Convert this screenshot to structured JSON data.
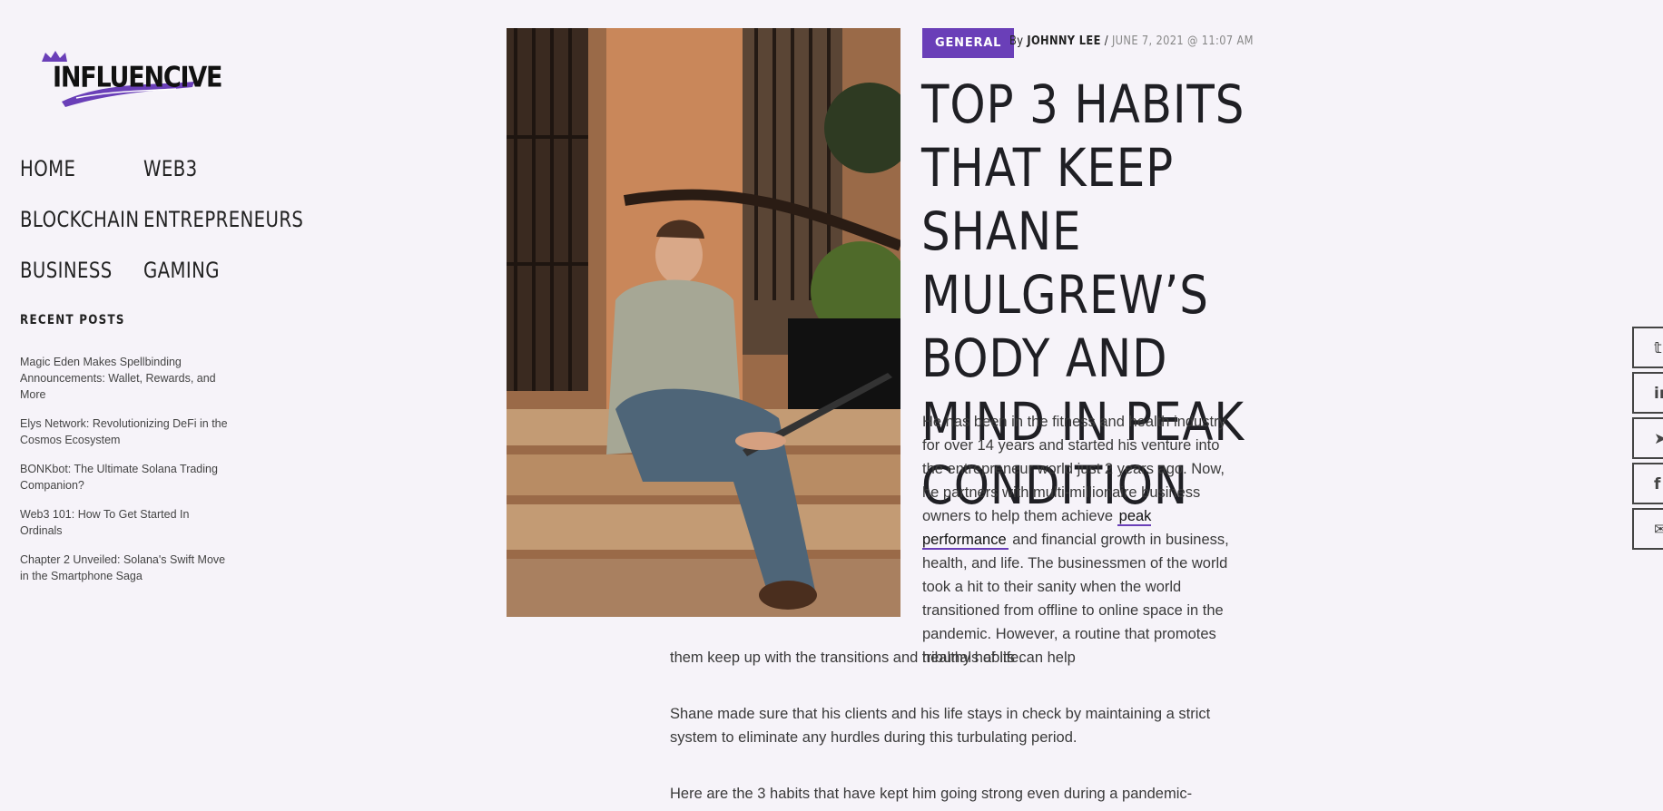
{
  "site": {
    "logo_text": "INFLUENCIVE"
  },
  "nav": {
    "items": [
      {
        "label": "HOME"
      },
      {
        "label": "WEB3"
      },
      {
        "label": "BLOCKCHAIN"
      },
      {
        "label": "ENTREPRENEURS"
      },
      {
        "label": "BUSINESS"
      },
      {
        "label": "GAMING"
      }
    ]
  },
  "sidebar": {
    "recent_title": "RECENT POSTS",
    "recent_posts": [
      "Magic Eden Makes Spellbinding Announcements: Wallet, Rewards, and More",
      "Elys Network: Revolutionizing DeFi in the Cosmos Ecosystem",
      "BONKbot: The Ultimate Solana Trading Companion?",
      "Web3 101: How To Get Started In Ordinals",
      "Chapter 2 Unveiled: Solana's Swift Move in the Smartphone Saga"
    ]
  },
  "article": {
    "category": "GENERAL",
    "by": "By",
    "author": "JOHNNY LEE",
    "separator": "/",
    "date": "JUNE 7, 2021 @ 11:07 AM",
    "title": "TOP 3 HABITS THAT KEEP SHANE MULGREW’S BODY AND MIND IN PEAK CONDITION",
    "p1_a": "He has been in the fitness and health industry for over 14 years and started his venture into the entrepreneur world just 2 years ago. Now, he partners with multi-millionaire business owners to help them achieve",
    "p1_link": "peak performance",
    "p1_b": "and financial growth in business, health, and life. The businessmen of the world took a hit to their sanity when the world transitioned from offline to online space in the pandemic. However, a routine that promotes healthy habits can help",
    "p1_c": "them keep up with the transitions and tribunals of life.",
    "p2": "Shane made sure that his clients and his life stays in check by maintaining a strict system to eliminate any hurdles during this turbulating period.",
    "p3": "Here are the 3 habits that have kept him going strong even during a pandemic-"
  },
  "share": {
    "icons": [
      "twitter-icon",
      "linkedin-icon",
      "telegram-icon",
      "facebook-icon",
      "email-icon"
    ],
    "glyphs": [
      "𝕥",
      "in",
      "➤",
      "f",
      "✉"
    ]
  },
  "colors": {
    "accent": "#6a3fb8",
    "background": "#f6f3f9"
  }
}
